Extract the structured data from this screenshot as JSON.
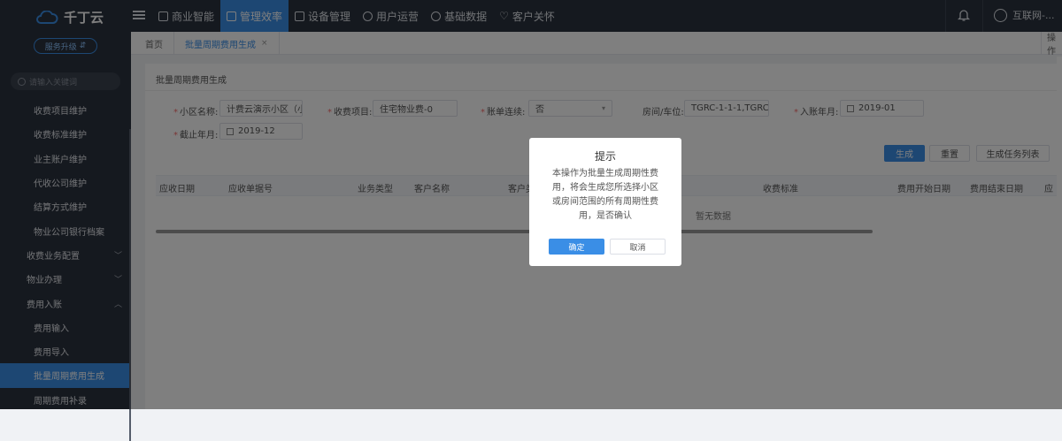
{
  "app": {
    "logo_text": "千丁云"
  },
  "nav": {
    "items": [
      "商业智能",
      "管理效率",
      "设备管理",
      "用户运营",
      "基础数据",
      "客户关怀"
    ],
    "active_index": 1
  },
  "user": {
    "name": "互联网-..."
  },
  "sidebar": {
    "upgrade_label": "服务升级",
    "search_placeholder": "请输入关键词",
    "items": [
      {
        "label": "收费项目维护",
        "level": 2
      },
      {
        "label": "收费标准维护",
        "level": 2
      },
      {
        "label": "业主账户维护",
        "level": 2
      },
      {
        "label": "代收公司维护",
        "level": 2
      },
      {
        "label": "结算方式维护",
        "level": 2
      },
      {
        "label": "物业公司银行档案",
        "level": 2
      },
      {
        "label": "收费业务配置",
        "level": 1,
        "chevron": "down"
      },
      {
        "label": "物业办理",
        "level": 1,
        "chevron": "down"
      },
      {
        "label": "费用入账",
        "level": 1,
        "chevron": "up"
      },
      {
        "label": "费用输入",
        "level": 2
      },
      {
        "label": "费用导入",
        "level": 2
      },
      {
        "label": "批量周期费用生成",
        "level": 2,
        "active": true
      },
      {
        "label": "周期费用补录",
        "level": 2
      }
    ]
  },
  "tabs": {
    "home": "首页",
    "current": "批量周期费用生成",
    "close": "×",
    "ops": "操作"
  },
  "page": {
    "title": "批量周期费用生成"
  },
  "form": {
    "community_label": "小区名称:",
    "community_value": "计费云演示小区（小",
    "charge_item_label": "收费项目:",
    "charge_item_value": "住宅物业费-0",
    "bill_continuous_label": "账单连续:",
    "bill_continuous_value": "否",
    "room_label": "房间/车位:",
    "room_value": "TGRC-1-1-1,TGRC-",
    "start_month_label": "入账年月:",
    "start_month_value": "2019-01",
    "end_month_label": "截止年月:",
    "end_month_value": "2019-12"
  },
  "buttons": {
    "generate": "生成",
    "reset": "重置",
    "task_list": "生成任务列表"
  },
  "table": {
    "columns": [
      "应收日期",
      "应收单据号",
      "业务类型",
      "客户名称",
      "客户类",
      "收费标准",
      "费用开始日期",
      "费用结束日期",
      "应"
    ],
    "empty_text": "暂无数据"
  },
  "dialog": {
    "title": "提示",
    "message": "本操作为批量生成周期性费用，将会生成您所选择小区或房间范围的所有周期性费用，是否确认",
    "confirm": "确定",
    "cancel": "取消"
  },
  "colors": {
    "accent": "#3a8ee6",
    "topbar": "#2b323e",
    "required": "#f56c6c"
  }
}
